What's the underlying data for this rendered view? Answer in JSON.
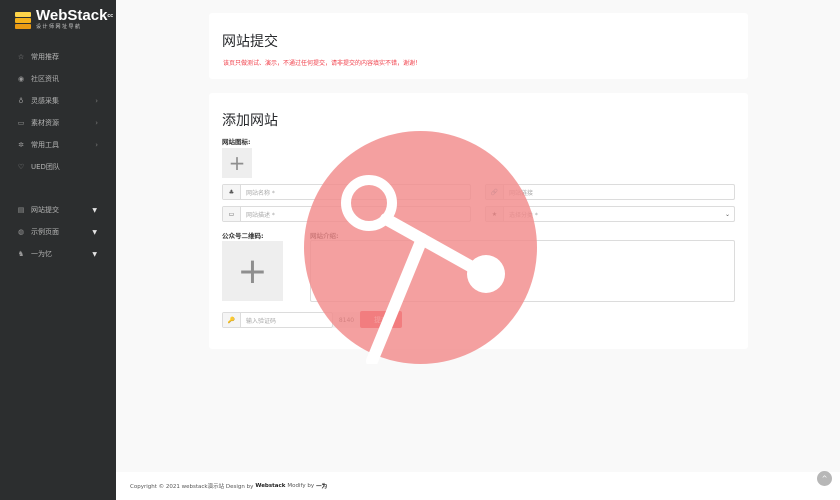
{
  "logo": {
    "title": "WebStack",
    "badge": "cc",
    "subtitle": "设计师网址导航"
  },
  "sidebar": {
    "items": [
      {
        "label": "常用推荐",
        "icon": "star-icon",
        "glyph": "☆"
      },
      {
        "label": "社区资讯",
        "icon": "broadcast-icon",
        "glyph": "◉"
      },
      {
        "label": "灵感采集",
        "icon": "lightbulb-icon",
        "glyph": "♁",
        "arrow": "›"
      },
      {
        "label": "素材资源",
        "icon": "folder-icon",
        "glyph": "▭",
        "arrow": "›"
      },
      {
        "label": "常用工具",
        "icon": "gear-icon",
        "glyph": "✲",
        "arrow": "›"
      },
      {
        "label": "UED团队",
        "icon": "heart-icon",
        "glyph": "♡"
      }
    ],
    "items2": [
      {
        "label": "网站提交",
        "icon": "monitor-icon",
        "glyph": "▤",
        "caret": "▼"
      },
      {
        "label": "示例页面",
        "icon": "globe-icon",
        "glyph": "◍",
        "caret": "▼"
      },
      {
        "label": "一为忆",
        "icon": "user-icon",
        "glyph": "♞",
        "caret": "▼"
      }
    ]
  },
  "card1": {
    "title": "网站提交",
    "notice": "该页只做测试、演示，不通过任何提交，请非提交的内容填实不错，谢谢！"
  },
  "form": {
    "title": "添加网站",
    "icon_label": "网站图标:",
    "upload_glyph": "+",
    "name_placeholder": "网站名称 *",
    "url_placeholder": "网站链接",
    "desc_placeholder": "网站描述 *",
    "category_placeholder": "选择分类 *",
    "category_caret": "⌄",
    "qr_label": "公众号二维码:",
    "intro_label": "网站介绍:",
    "captcha_placeholder": "输入验证码",
    "captcha_code": "8140",
    "submit_label": "提交",
    "addon_name": "♣",
    "addon_url": "🔗",
    "addon_desc": "▭",
    "addon_category": "★",
    "addon_captcha": "🔑"
  },
  "footer": {
    "prefix": "Copyright © 2021 webstack演示站  Design by",
    "design_by": "Webstack",
    "modify_text": "Modify by",
    "modify_by": "一为",
    "go_top": "^"
  },
  "colors": {
    "accent": "#f1404b",
    "sidebar": "#2c2e2f",
    "watermark": "#f28b8b"
  }
}
